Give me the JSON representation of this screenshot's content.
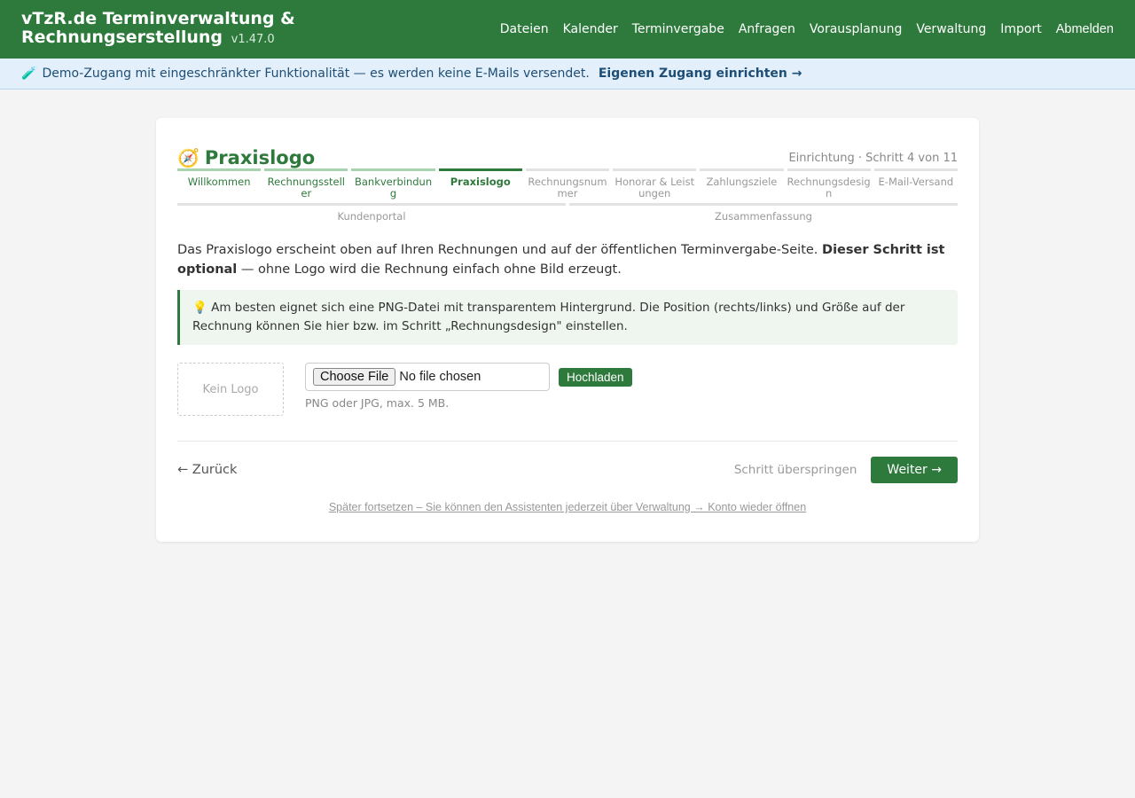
{
  "header": {
    "title": "vTzR.de Terminverwaltung & Rechnungserstellung",
    "version": "v1.47.0",
    "nav": [
      "Dateien",
      "Kalender",
      "Terminvergabe",
      "Anfragen",
      "Vorausplanung",
      "Verwaltung",
      "Import"
    ],
    "logout": "Abmelden"
  },
  "demo_bar": {
    "icon": "🧪",
    "text": "Demo-Zugang mit eingeschränkter Funktionalität — es werden keine E-Mails versendet.",
    "link": "Eigenen Zugang einrichten →"
  },
  "wizard": {
    "icon": "🧭",
    "title": "Praxislogo",
    "step_meta": "Einrichtung · Schritt 4 von 11",
    "steps_row1": [
      {
        "label": "Willkommen",
        "state": "done"
      },
      {
        "label": "Rechnungssteller",
        "state": "done"
      },
      {
        "label": "Bankverbindung",
        "state": "done"
      },
      {
        "label": "Praxislogo",
        "state": "active"
      },
      {
        "label": "Rechnungsnummer",
        "state": "todo"
      },
      {
        "label": "Honorar & Leistungen",
        "state": "todo"
      },
      {
        "label": "Zahlungsziele",
        "state": "todo"
      },
      {
        "label": "Rechnungsdesign",
        "state": "todo"
      },
      {
        "label": "E-Mail-Versand",
        "state": "todo"
      }
    ],
    "steps_row2": [
      {
        "label": "Kundenportal",
        "state": "todo"
      },
      {
        "label": "Zusammenfassung",
        "state": "todo"
      }
    ],
    "intro_text": "Das Praxislogo erscheint oben auf Ihren Rechnungen und auf der öffentlichen Terminvergabe-Seite. ",
    "intro_bold": "Dieser Schritt ist optional",
    "intro_rest": " — ohne Logo wird die Rechnung einfach ohne Bild erzeugt.",
    "hint_icon": "💡",
    "hint": "Am besten eignet sich eine PNG-Datei mit transparentem Hintergrund. Die Position (rechts/links) und Größe auf der Rechnung können Sie hier bzw. im Schritt „Rechnungsdesign\" einstellen.",
    "logo_placeholder": "Kein Logo",
    "choose_file": "Choose File",
    "no_file": "No file chosen",
    "upload_button": "Hochladen",
    "file_help": "PNG oder JPG, max. 5 MB.",
    "back": "← Zurück",
    "skip": "Schritt überspringen",
    "next": "Weiter →",
    "later": "Später fortsetzen – Sie können den Assistenten jederzeit über Verwaltung → Konto wieder öffnen"
  },
  "colors": {
    "primary": "#2e7a3c",
    "demo_bg": "#e3f0fb"
  }
}
